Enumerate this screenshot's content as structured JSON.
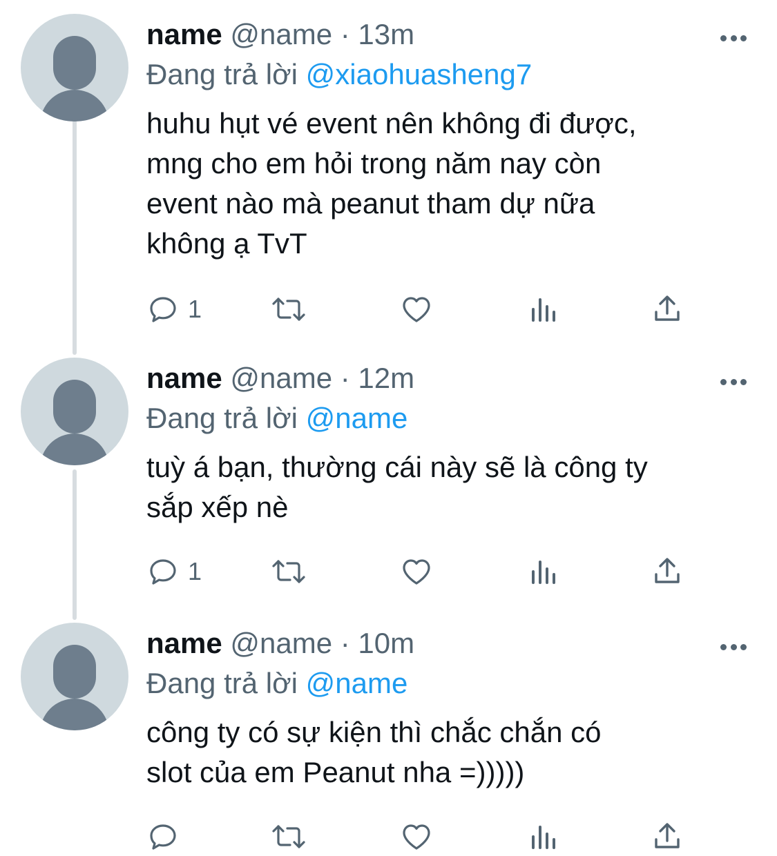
{
  "thread": [
    {
      "display_name": "name",
      "handle": "@name",
      "time": "13m",
      "replying_prefix": "Đang trả lời",
      "replying_to": "@xiaohuasheng7",
      "text": "huhu hụt vé event nên không đi được,\nmng cho em hỏi trong năm nay còn\nevent nào mà peanut tham dự nữa\nkhông ạ TvT",
      "reply_count": "1",
      "retweet_count": "",
      "like_count": ""
    },
    {
      "display_name": "name",
      "handle": "@name",
      "time": "12m",
      "replying_prefix": "Đang trả lời",
      "replying_to": "@name",
      "text": "tuỳ á bạn, thường cái này sẽ là công ty\nsắp xếp nè",
      "reply_count": "1",
      "retweet_count": "",
      "like_count": ""
    },
    {
      "display_name": "name",
      "handle": "@name",
      "time": "10m",
      "replying_prefix": "Đang trả lời",
      "replying_to": "@name",
      "text": "công ty có sự kiện thì chắc chắn có\nslot của em Peanut nha =)))))",
      "reply_count": "",
      "retweet_count": "",
      "like_count": ""
    }
  ],
  "separator": " · ",
  "icons": {
    "reply": "speech-bubble-icon",
    "retweet": "retweet-arrows-icon",
    "like": "heart-outline-icon",
    "analytics": "bar-chart-icon",
    "share": "share-upload-icon",
    "more": "more-dots-icon"
  },
  "colors": {
    "text": "#0f1419",
    "secondary": "#536471",
    "link": "#1d9bf0",
    "avatar_bg": "#cfd9de",
    "avatar_fg": "#6e7e8d",
    "thread_line": "#d7dce0"
  }
}
